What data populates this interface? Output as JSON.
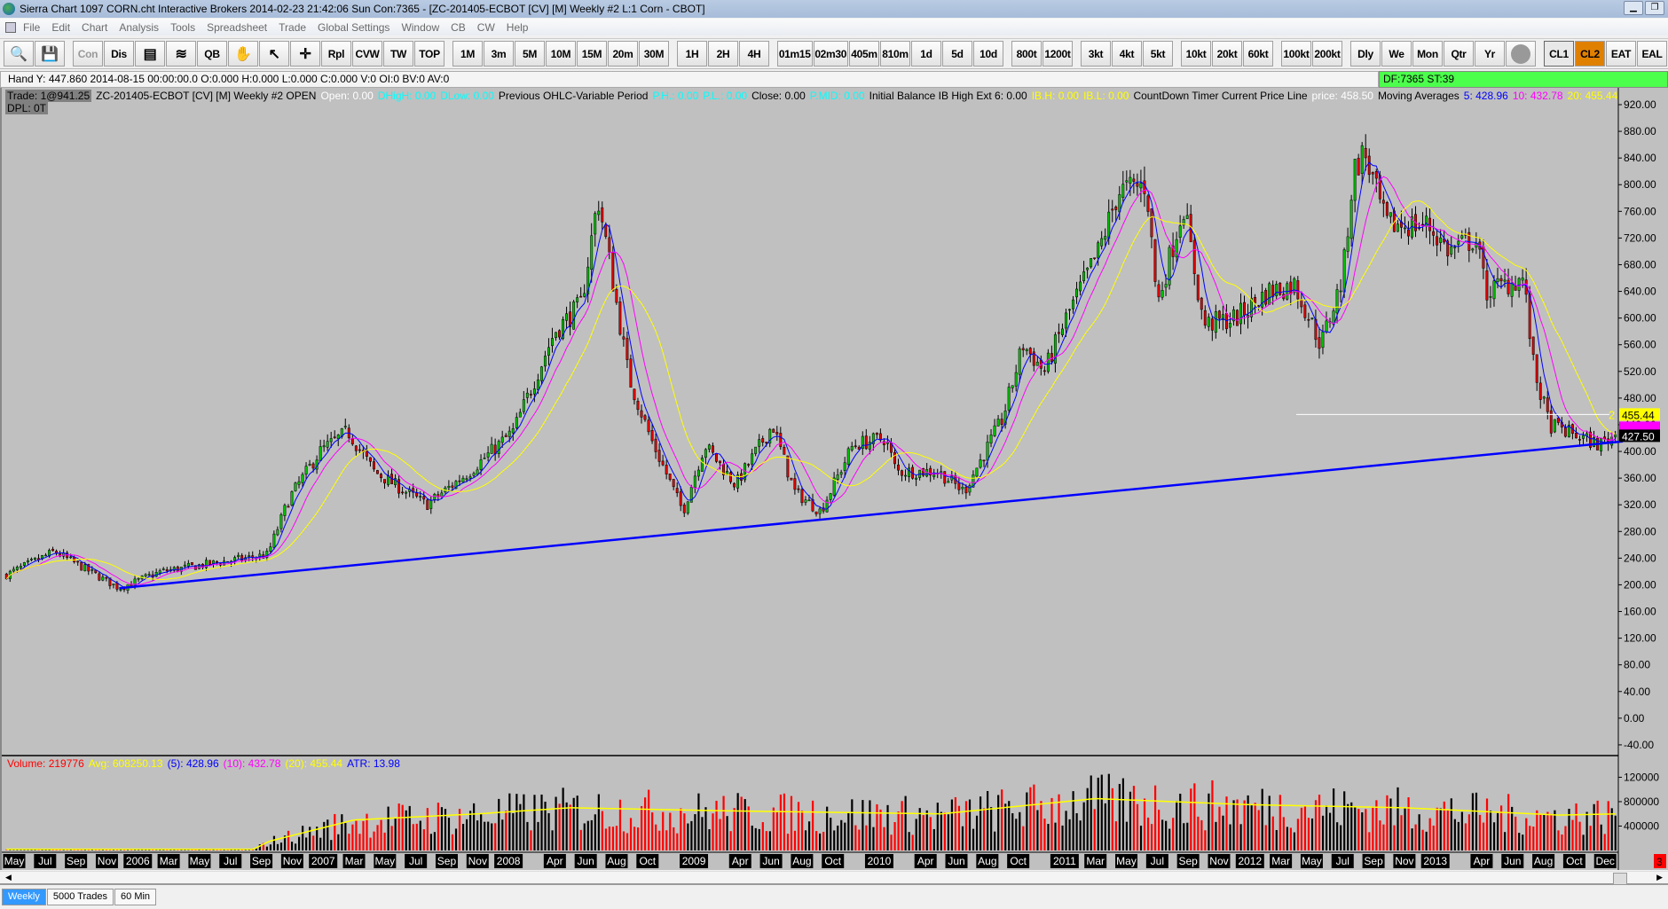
{
  "window": {
    "title": "Sierra Chart 1097 CORN.cht  Interactive Brokers 2014-02-23  21:42:06 Sun  Con:7365 - [ZC-201405-ECBOT [CV] [M]  Weekly  #2  L:1  Corn - CBOT]"
  },
  "menu": [
    "File",
    "Edit",
    "Chart",
    "Analysis",
    "Tools",
    "Spreadsheet",
    "Trade",
    "Global Settings",
    "Window",
    "CB",
    "CW",
    "Help"
  ],
  "toolbar": {
    "left": [
      {
        "l": "Con",
        "c": "grey"
      },
      {
        "l": "Dis"
      },
      {
        "l": "QB",
        "pre": 2
      },
      {
        "l": "Rpl",
        "pre": 3
      },
      {
        "l": "CVW"
      },
      {
        "l": "TW"
      },
      {
        "l": "TOP"
      }
    ],
    "groups": [
      [
        "1M",
        "3m",
        "5M",
        "10M",
        "15M",
        "20m",
        "30M"
      ],
      [
        "1H",
        "2H",
        "4H"
      ],
      [
        "01m15",
        "02m30",
        "405m",
        "810m",
        "1d",
        "5d",
        "10d"
      ],
      [
        "800t",
        "1200t"
      ],
      [
        "3kt",
        "4kt",
        "5kt"
      ],
      [
        "10kt",
        "20kt",
        "60kt"
      ],
      [
        "100kt",
        "200kt"
      ],
      [
        "Dly",
        "We",
        "Mon",
        "Qtr",
        "Yr"
      ]
    ],
    "right": [
      "CL1",
      "CL2",
      "EAT",
      "EAL"
    ]
  },
  "hud": {
    "text": "Hand Y: 447.860  2014-08-15  00:00:00.0  O:0.000  H:0.000  L:0.000  C:0.000  V:0  OI:0  BV:0  AV:0",
    "df": "DF:7365  ST:39"
  },
  "study": {
    "trade": "Trade: 1@941.25",
    "segments": [
      {
        "t": "ZC-201405-ECBOT [CV] [M]  Weekly  #2 OPEN",
        "c": "#000000"
      },
      {
        "t": "Open: 0.00",
        "c": "#ffffff"
      },
      {
        "t": "DHigH: 0.00",
        "c": "#00ffff"
      },
      {
        "t": "DLow: 0.00",
        "c": "#00ffff"
      },
      {
        "t": "Previous OHLC-Variable Period",
        "c": "#000000"
      },
      {
        "t": "P.H.: 0.00",
        "c": "#00ffff"
      },
      {
        "t": "P.L.: 0.00",
        "c": "#00ffff"
      },
      {
        "t": "Close: 0.00",
        "c": "#000000"
      },
      {
        "t": "P.MID: 0.00",
        "c": "#00ffff"
      },
      {
        "t": "Initial Balance  IB High Ext 6: 0.00",
        "c": "#000000"
      },
      {
        "t": "IB.H: 0.00",
        "c": "#ffff00"
      },
      {
        "t": "IB.L: 0.00",
        "c": "#ffff00"
      },
      {
        "t": "CountDown Timer  Current Price Line",
        "c": "#000000"
      },
      {
        "t": "price: 458.50",
        "c": "#ffffff"
      },
      {
        "t": "Moving Averages",
        "c": "#000000"
      },
      {
        "t": "5: 428.96",
        "c": "#0000ff"
      },
      {
        "t": "10: 432.78",
        "c": "#ff00ff"
      },
      {
        "t": "20: 455.44",
        "c": "#ffff00"
      }
    ],
    "dpl": "DPL: 0T"
  },
  "volume_study": [
    {
      "t": "Volume: 219776",
      "c": "#ff0000"
    },
    {
      "t": "Avg: 608250.13",
      "c": "#ffff00"
    },
    {
      "t": "(5): 428.96",
      "c": "#0000ff"
    },
    {
      "t": "(10): 432.78",
      "c": "#ff00ff"
    },
    {
      "t": "(20): 455.44",
      "c": "#ffff00"
    },
    {
      "t": "ATR: 13.98",
      "c": "#0000ff"
    }
  ],
  "tabs": [
    "Weekly",
    "5000 Trades",
    "60 Min"
  ],
  "colors": {
    "up": "#00c000",
    "down": "#e00000",
    "ma5": "#0000ff",
    "ma10": "#ff00ff",
    "ma20": "#ffff00",
    "trend": "#0000ff"
  },
  "chart_data": {
    "type": "candlestick",
    "symbol": "ZC-201405-ECBOT",
    "price_axis": {
      "min": -40,
      "max": 920,
      "step": 40,
      "ticks": [
        "920.00",
        "880.00",
        "840.00",
        "800.00",
        "760.00",
        "720.00",
        "680.00",
        "640.00",
        "600.00",
        "560.00",
        "520.00",
        "480.00",
        "440.00",
        "400.00",
        "360.00",
        "320.00",
        "280.00",
        "240.00",
        "200.00",
        "160.00",
        "120.00",
        "80.00",
        "40.00",
        "0.00",
        "-40.00"
      ]
    },
    "price_path_months_from_may2005": [
      [
        -0.5,
        215
      ],
      [
        2.6,
        250
      ],
      [
        6.8,
        195
      ],
      [
        9.5,
        220
      ],
      [
        16.4,
        245
      ],
      [
        17.8,
        330
      ],
      [
        19.8,
        400
      ],
      [
        21.6,
        430
      ],
      [
        23.3,
        370
      ],
      [
        26.7,
        320
      ],
      [
        29.5,
        370
      ],
      [
        32.3,
        430
      ],
      [
        35,
        580
      ],
      [
        36.7,
        620
      ],
      [
        37.8,
        780
      ],
      [
        38.5,
        690
      ],
      [
        39.8,
        510
      ],
      [
        41.2,
        420
      ],
      [
        43.3,
        310
      ],
      [
        44.7,
        410
      ],
      [
        46.7,
        350
      ],
      [
        49.1,
        440
      ],
      [
        50.5,
        340
      ],
      [
        52.2,
        310
      ],
      [
        54.3,
        410
      ],
      [
        56.4,
        420
      ],
      [
        57.1,
        370
      ],
      [
        59.8,
        370
      ],
      [
        61.5,
        340
      ],
      [
        64,
        450
      ],
      [
        65.3,
        560
      ],
      [
        66.7,
        520
      ],
      [
        68.1,
        600
      ],
      [
        70.2,
        700
      ],
      [
        71.5,
        790
      ],
      [
        73.3,
        800
      ],
      [
        74,
        620
      ],
      [
        75.7,
        770
      ],
      [
        77,
        590
      ],
      [
        79.1,
        600
      ],
      [
        81.2,
        640
      ],
      [
        82.9,
        650
      ],
      [
        84.6,
        560
      ],
      [
        86,
        660
      ],
      [
        86.7,
        820
      ],
      [
        87.4,
        850
      ],
      [
        88.8,
        740
      ],
      [
        91.5,
        740
      ],
      [
        92.9,
        700
      ],
      [
        94.6,
        720
      ],
      [
        95.3,
        640
      ],
      [
        97.7,
        660
      ],
      [
        98.4,
        520
      ],
      [
        99.4,
        440
      ],
      [
        100.5,
        430
      ],
      [
        102.6,
        410
      ],
      [
        103.8,
        427.5
      ]
    ],
    "trendline": [
      [
        6.8,
        195
      ],
      [
        103.8,
        415
      ]
    ],
    "price_markers": [
      {
        "label": "455.44",
        "bg": "#ffff00",
        "fg": "#000000",
        "num": "2"
      },
      {
        "label": "432.78",
        "bg": "#ff00ff",
        "fg": "#ff00ff",
        "num": ""
      },
      {
        "label": "427.50",
        "bg": "#000000",
        "fg": "#ffffff",
        "num": "1"
      }
    ],
    "volume_axis": {
      "ticks": [
        {
          "v": 1200000,
          "label": "120000"
        },
        {
          "v": 800000,
          "label": "800000"
        },
        {
          "v": 400000,
          "label": "400000"
        }
      ]
    },
    "volume_avg_path": [
      [
        0,
        20000
      ],
      [
        15.5,
        20000
      ],
      [
        16.5,
        150000
      ],
      [
        22,
        500000
      ],
      [
        30,
        600000
      ],
      [
        36,
        700000
      ],
      [
        46,
        650000
      ],
      [
        60,
        600000
      ],
      [
        70,
        850000
      ],
      [
        80,
        750000
      ],
      [
        90,
        700000
      ],
      [
        100,
        580000
      ],
      [
        103.8,
        600000
      ]
    ],
    "date_labels": [
      [
        "May",
        0
      ],
      [
        "Jul",
        2
      ],
      [
        "Sep",
        4
      ],
      [
        "Nov",
        6
      ],
      [
        "2006",
        8
      ],
      [
        "Mar",
        10
      ],
      [
        "May",
        12
      ],
      [
        "Jul",
        14
      ],
      [
        "Sep",
        16
      ],
      [
        "Nov",
        18
      ],
      [
        "2007",
        20
      ],
      [
        "Mar",
        22
      ],
      [
        "May",
        24
      ],
      [
        "Jul",
        26
      ],
      [
        "Sep",
        28
      ],
      [
        "Nov",
        30
      ],
      [
        "2008",
        32
      ],
      [
        "Apr",
        35
      ],
      [
        "Jun",
        37
      ],
      [
        "Aug",
        39
      ],
      [
        "Oct",
        41
      ],
      [
        "2009",
        44
      ],
      [
        "Apr",
        47
      ],
      [
        "Jun",
        49
      ],
      [
        "Aug",
        51
      ],
      [
        "Oct",
        53
      ],
      [
        "2010",
        56
      ],
      [
        "Apr",
        59
      ],
      [
        "Jun",
        61
      ],
      [
        "Aug",
        63
      ],
      [
        "Oct",
        65
      ],
      [
        "2011",
        68
      ],
      [
        "Mar",
        70
      ],
      [
        "May",
        72
      ],
      [
        "Jul",
        74
      ],
      [
        "Sep",
        76
      ],
      [
        "Nov",
        78
      ],
      [
        "2012",
        80
      ],
      [
        "Mar",
        82
      ],
      [
        "May",
        84
      ],
      [
        "Jul",
        86
      ],
      [
        "Sep",
        88
      ],
      [
        "Nov",
        90
      ],
      [
        "2013",
        92
      ],
      [
        "Apr",
        95
      ],
      [
        "Jun",
        97
      ],
      [
        "Aug",
        99
      ],
      [
        "Oct",
        101
      ],
      [
        "Dec",
        103
      ]
    ],
    "corner_badge": "3"
  }
}
